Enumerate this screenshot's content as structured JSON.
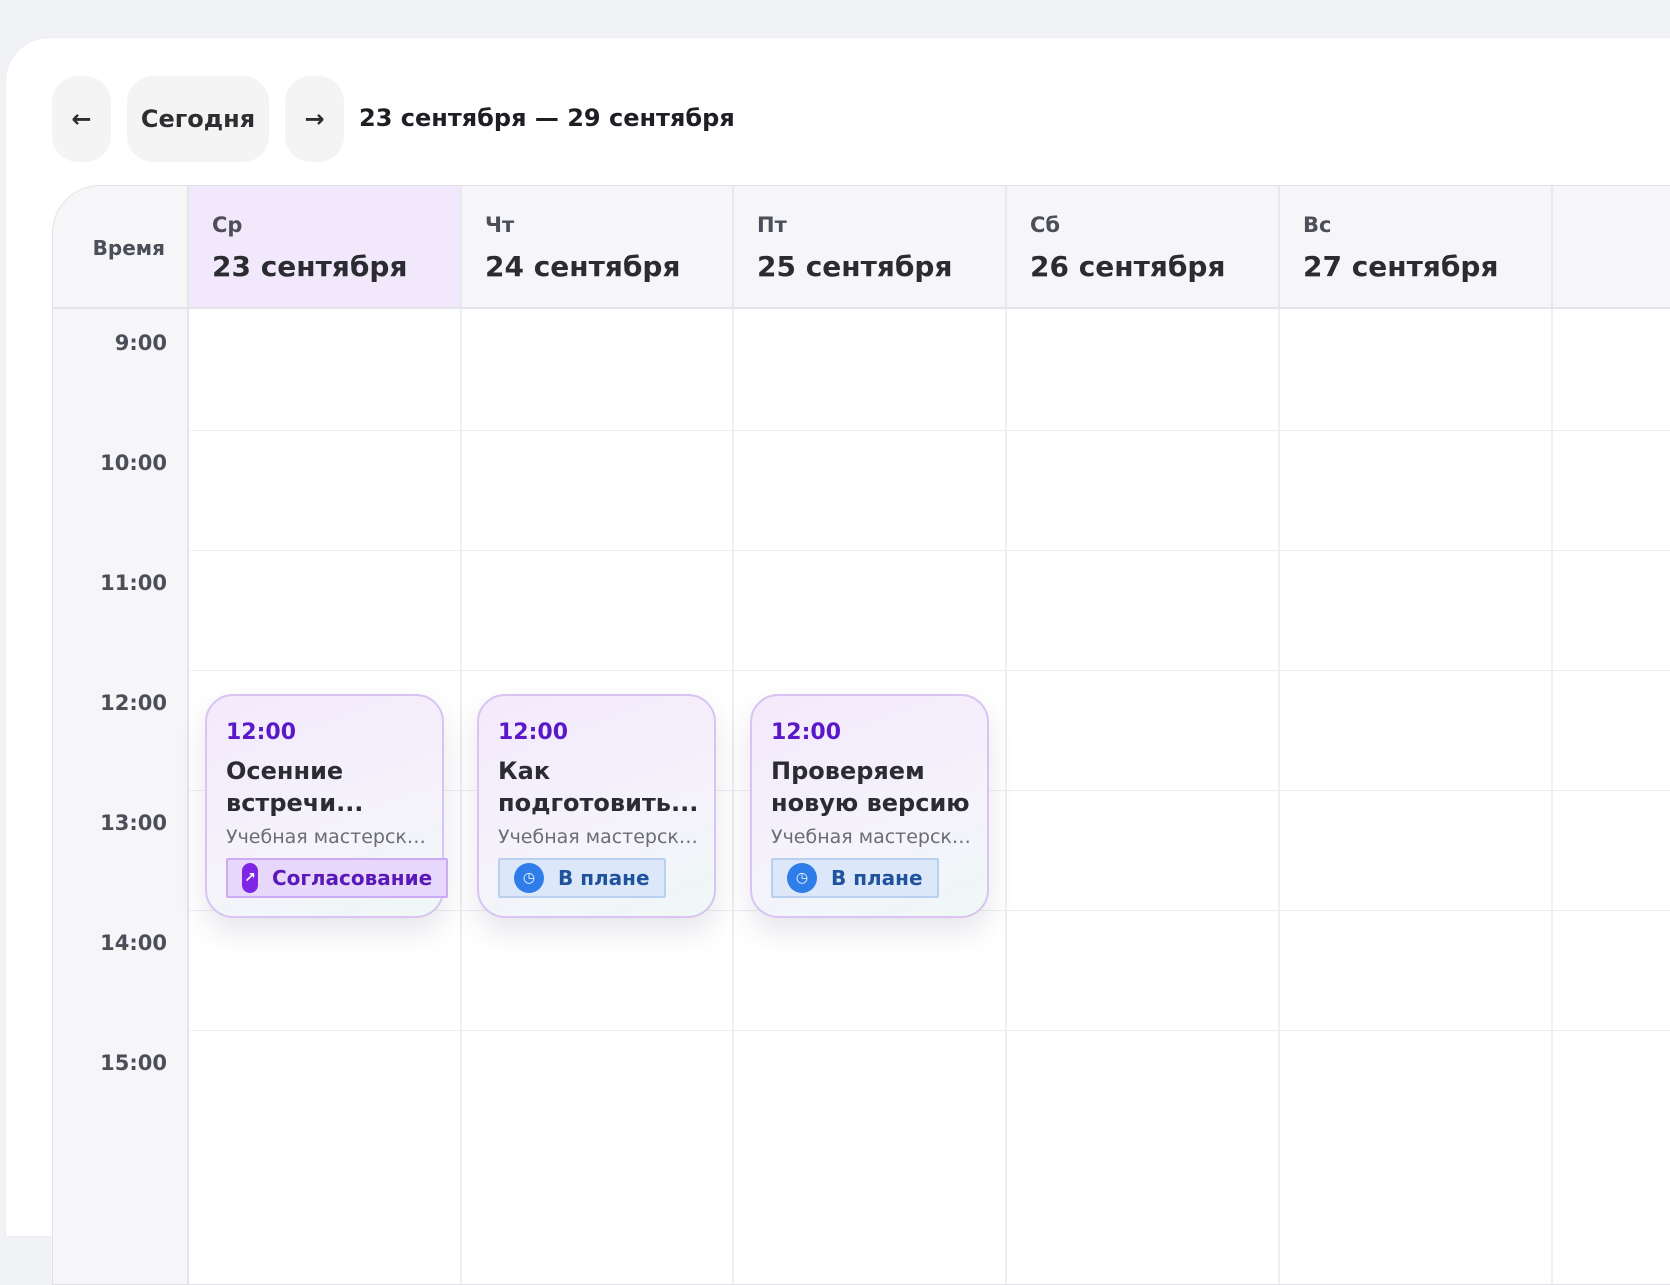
{
  "toolbar": {
    "prev_label": "←",
    "today_label": "Сегодня",
    "next_label": "→",
    "range_label": "23 сентября — 29 сентября"
  },
  "grid": {
    "time_header": "Время",
    "days": [
      {
        "abbr": "Ср",
        "date": "23 сентября",
        "is_today": true
      },
      {
        "abbr": "Чт",
        "date": "24 сентября",
        "is_today": false
      },
      {
        "abbr": "Пт",
        "date": "25 сентября",
        "is_today": false
      },
      {
        "abbr": "Сб",
        "date": "26 сентября",
        "is_today": false
      },
      {
        "abbr": "Вс",
        "date": "27 сентября",
        "is_today": false
      }
    ],
    "hours": [
      "9:00",
      "10:00",
      "11:00",
      "12:00",
      "13:00",
      "14:00",
      "15:00"
    ]
  },
  "events": [
    {
      "time": "12:00",
      "title": "Осенние встречи...",
      "subtitle": "Учебная мастерска...",
      "status": "Согласование",
      "status_icon": "approval-icon"
    },
    {
      "time": "12:00",
      "title": "Как подготовить...",
      "subtitle": "Учебная мастерска...",
      "status": "В плане",
      "status_icon": "clock-icon"
    },
    {
      "time": "12:00",
      "title": "Проверяем новую версию",
      "subtitle": "Учебная мастерска...",
      "status": "В плане",
      "status_icon": "clock-icon"
    }
  ],
  "colors": {
    "accent": "#5b18c9",
    "today_bg": "#f2e8fb",
    "plan_badge": "#dce8f9",
    "approve_badge": "#e7d7fa"
  }
}
